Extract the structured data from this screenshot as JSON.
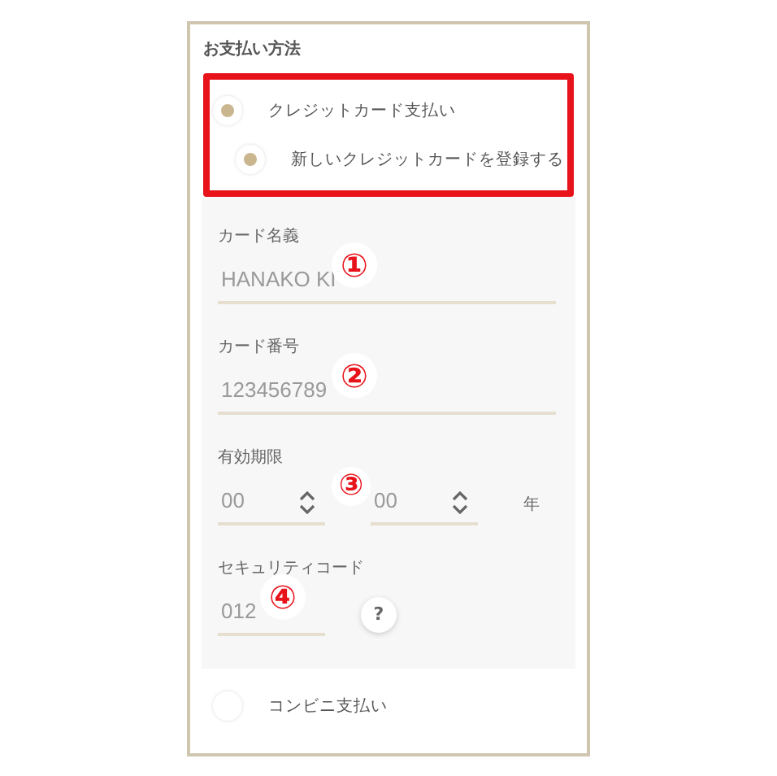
{
  "section": {
    "title": "お支払い方法"
  },
  "payment_methods": [
    {
      "label": "クレジットカード支払い",
      "selected": true,
      "annotation_frame": true,
      "sub_options": [
        {
          "label": "新しいクレジットカードを登録する",
          "selected": true
        }
      ],
      "form": [
        {
          "kind": "text",
          "label": "カード名義",
          "placeholder": "HANAKO KI",
          "marker": "①"
        },
        {
          "kind": "text",
          "label": "カード番号",
          "placeholder": "123456789",
          "marker": "②"
        },
        {
          "kind": "expiry",
          "label": "有効期限",
          "month_placeholder": "00",
          "year_placeholder": "00",
          "unit": "年",
          "marker": "③"
        },
        {
          "kind": "security",
          "label": "セキュリティコード",
          "placeholder": "012",
          "help": "?",
          "marker": "④"
        }
      ]
    },
    {
      "label": "コンビニ支払い",
      "selected": false,
      "annotation_frame": false
    }
  ]
}
